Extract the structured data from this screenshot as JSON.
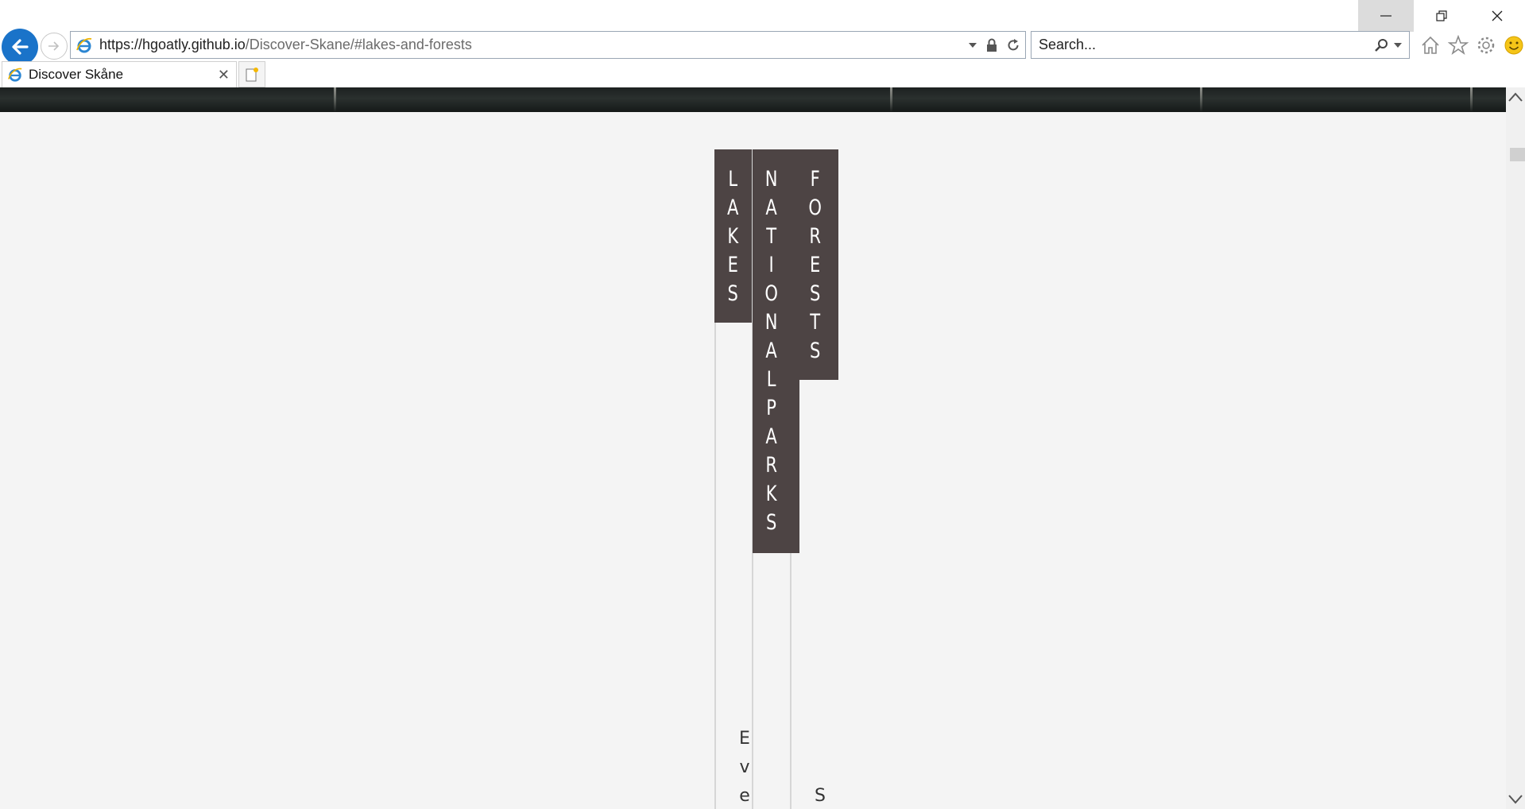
{
  "browser": {
    "url_host": "https://hgoatly.github.io",
    "url_path": "/Discover-Skane/#lakes-and-forests",
    "search_placeholder": "Search...",
    "tab_title": "Discover Skåne",
    "icons": [
      "back-icon",
      "forward-icon",
      "ie-logo-icon",
      "dropdown-icon",
      "lock-icon",
      "refresh-icon",
      "search-icon",
      "home-icon",
      "favorites-star-icon",
      "settings-gear-icon",
      "feedback-smiley-icon",
      "close-icon",
      "new-tab-icon",
      "minimize-icon",
      "restore-icon"
    ]
  },
  "page": {
    "columns": [
      {
        "label": "LAKES",
        "text": "Eve"
      },
      {
        "label": "NATIONALPARKS",
        "text": ""
      },
      {
        "label": "FORESTS",
        "text": "S"
      }
    ],
    "colors": {
      "background": "#f4f4f4",
      "label_bg": "#4d4444",
      "label_text": "#ffffff"
    }
  }
}
